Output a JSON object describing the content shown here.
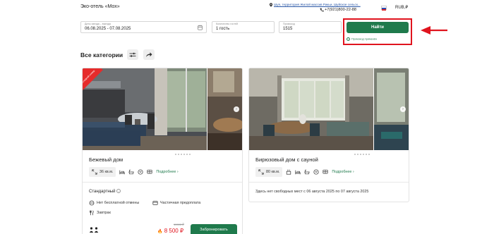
{
  "header": {
    "hotel_name": "Эко-отель «Мох»",
    "address": "Шуя, территория Жилой массив Рикьи, Шуйское сельск...",
    "phone": "+7(921)800-22-88",
    "currency": "RUB,₽"
  },
  "search": {
    "dates_label": "Даты заезда – выезда",
    "dates_value": "06.08.2025 - 07.08.2025",
    "guests_label": "Количество гостей",
    "guests_value": "1 гость",
    "promo_label": "Промокод",
    "promo_value": "1515",
    "find_label": "Найти",
    "promo_status": "Промокод применён"
  },
  "categories": {
    "title": "Все категории"
  },
  "cards": [
    {
      "ribbon": "Последний номер",
      "title": "Бежевый дом",
      "area": "36 кв.м.",
      "more": "Подробнее",
      "rate_name": "Стандартный",
      "rate_cancel": "Нет бесплатной отмены",
      "rate_prepay": "Частичная предоплата",
      "rate_meal": "Завтрак",
      "old_price": "10000 ₽",
      "price": "8 500 ₽",
      "book_label": "Забронировать"
    },
    {
      "title": "Бирюзовый дом с сауной",
      "area": "80 кв.м.",
      "more": "Подробнее",
      "availability": "Здесь нет свободных мест с 06 августа 2025 по 07 августа 2025"
    }
  ],
  "colors": {
    "accent_green": "#1f7a4c",
    "highlight_red": "#e0141e",
    "link_blue": "#2a57a6"
  }
}
